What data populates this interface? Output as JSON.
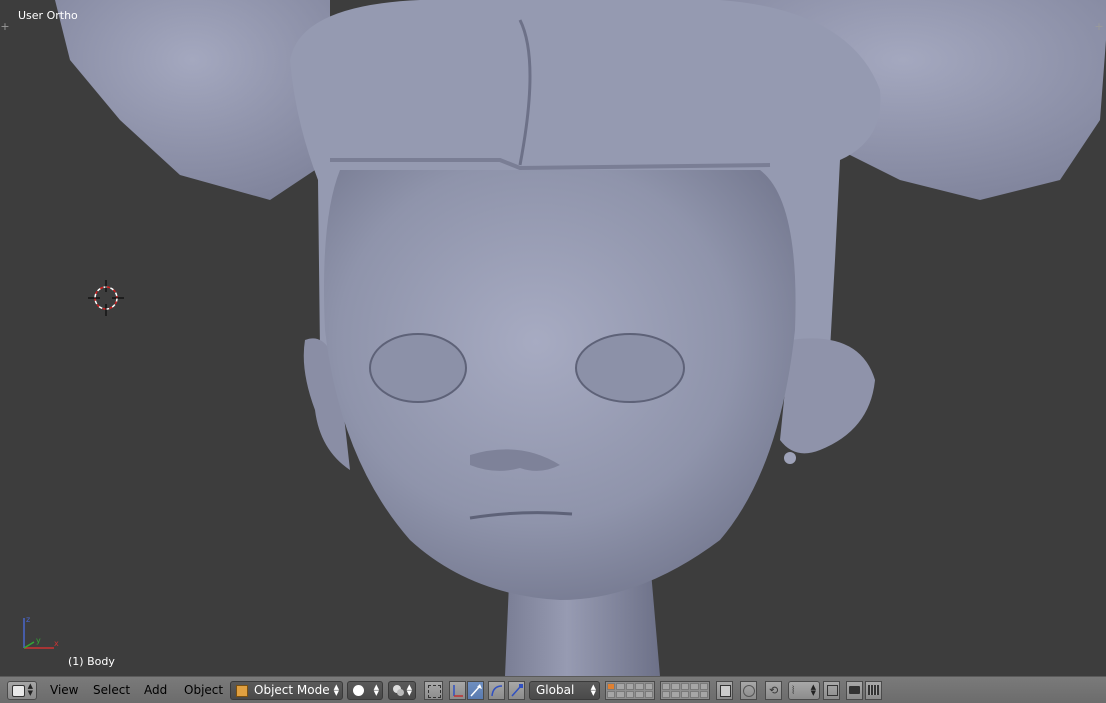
{
  "viewport": {
    "view_label": "User Ortho",
    "object_label": "(1) Body"
  },
  "header": {
    "menus": [
      "View",
      "Select",
      "Add",
      "Object"
    ],
    "mode": "Object Mode",
    "orientation": "Global"
  },
  "colors": {
    "viewport_bg": "#3d3d3d",
    "model": "#9296ad",
    "header_bg": "#737373",
    "active_blue": "#5a7bb0"
  },
  "icons": [
    "editor-type-icon",
    "viewport-shading-icon",
    "pivot-icon",
    "manipulator-icon",
    "translate-icon",
    "rotate-icon",
    "scale-icon",
    "layers-icon",
    "lock-layer-icon",
    "proportional-edit-icon",
    "snap-icon",
    "snap-element-icon",
    "render-icon",
    "render-animation-icon"
  ]
}
